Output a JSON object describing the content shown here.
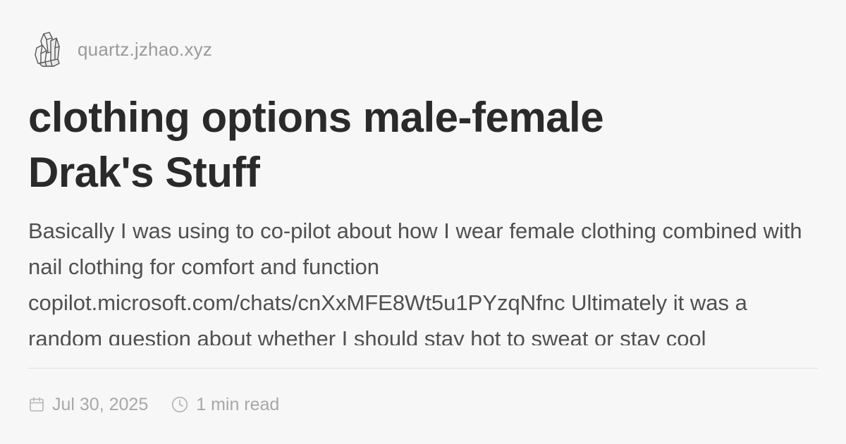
{
  "header": {
    "site_name": "quartz.jzhao.xyz",
    "logo_icon": "crystal-icon"
  },
  "article": {
    "title_line1": "clothing options male-female",
    "title_line2": "Drak's Stuff",
    "excerpt": "Basically I was using to co-pilot about how I wear female clothing combined with nail clothing for comfort and function copilot.microsoft.com/chats/cnXxMFE8Wt5u1PYzqNfnc Ultimately it was a random question about whether I should stay hot to sweat or stay cool"
  },
  "meta": {
    "date": "Jul 30, 2025",
    "date_icon": "calendar-icon",
    "read_time": "1 min read",
    "read_time_icon": "clock-icon"
  }
}
